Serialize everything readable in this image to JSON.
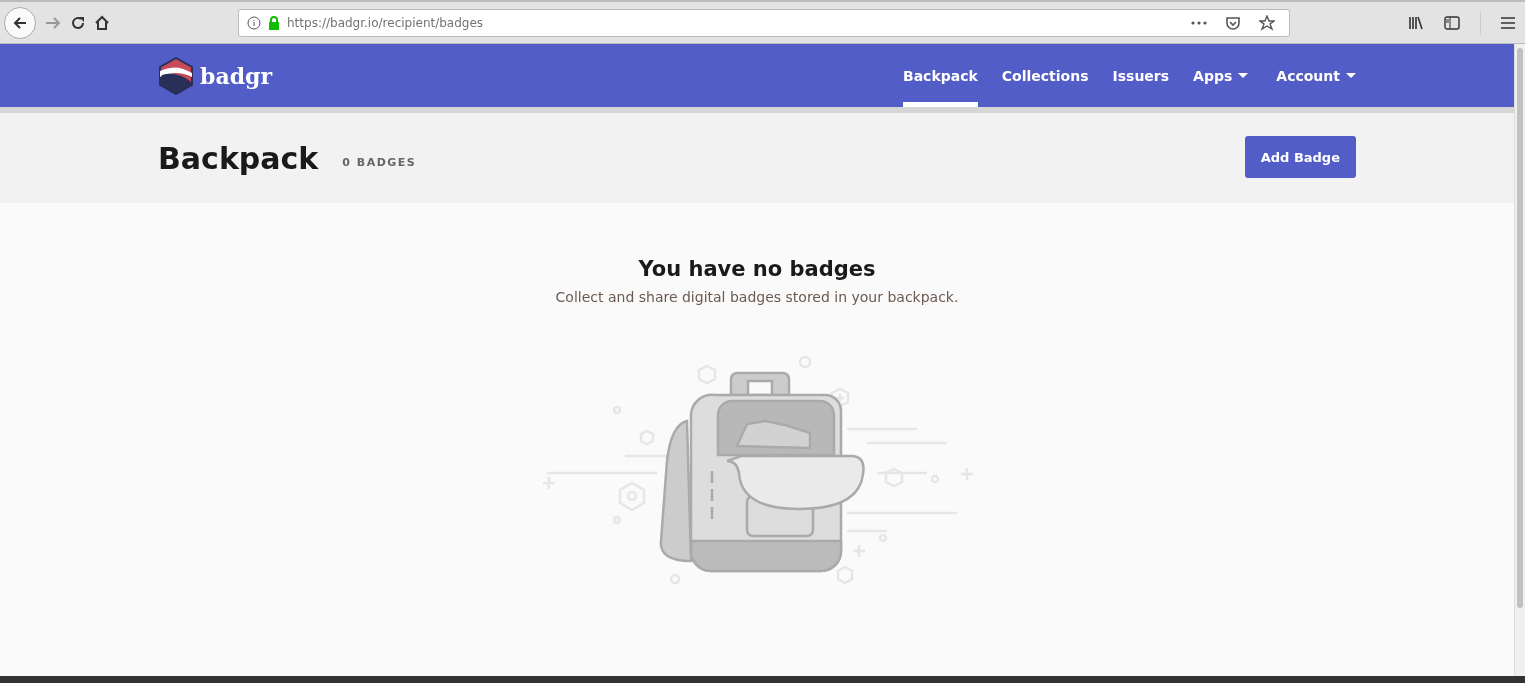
{
  "browser": {
    "url": "https://badgr.io/recipient/badges"
  },
  "nav": {
    "logo_text": "badgr",
    "items": [
      {
        "label": "Backpack",
        "selected": true,
        "dropdown": false
      },
      {
        "label": "Collections",
        "selected": false,
        "dropdown": false
      },
      {
        "label": "Issuers",
        "selected": false,
        "dropdown": false
      },
      {
        "label": "Apps",
        "selected": false,
        "dropdown": true
      },
      {
        "label": "Account",
        "selected": false,
        "dropdown": true
      }
    ]
  },
  "header": {
    "title": "Backpack",
    "count": "0 BADGES",
    "button": "Add Badge"
  },
  "empty_state": {
    "title": "You have no badges",
    "text": "Collect and share digital badges stored in your backpack."
  }
}
